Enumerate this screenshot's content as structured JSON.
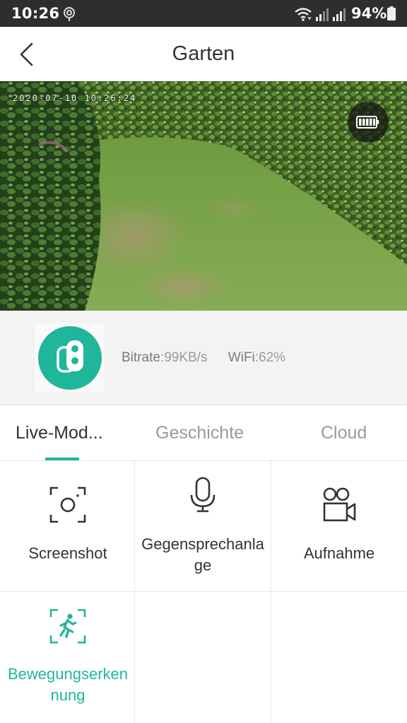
{
  "status_bar": {
    "time": "10:26",
    "battery": "94%"
  },
  "header": {
    "title": "Garten"
  },
  "video": {
    "timestamp": "2020-07-10 10:26:24"
  },
  "device_info": {
    "bitrate_label": "Bitrate",
    "bitrate_value": ":99KB/s",
    "wifi_label": "WiFi",
    "wifi_value": ":62%"
  },
  "tabs": [
    {
      "label": "Live-Mod..."
    },
    {
      "label": "Geschichte"
    },
    {
      "label": "Cloud"
    }
  ],
  "actions": {
    "screenshot": {
      "line1": "Screenshot",
      "line2": ""
    },
    "intercom": {
      "line1": "Gegensprechanla",
      "line2": "ge"
    },
    "record": {
      "line1": "Aufnahme",
      "line2": ""
    },
    "motion": {
      "line1": "Bewegungserken",
      "line2": "nung"
    }
  },
  "colors": {
    "accent": "#20b69a",
    "status_bar": "#2e2e2e",
    "info_background": "#f3f3f3"
  }
}
